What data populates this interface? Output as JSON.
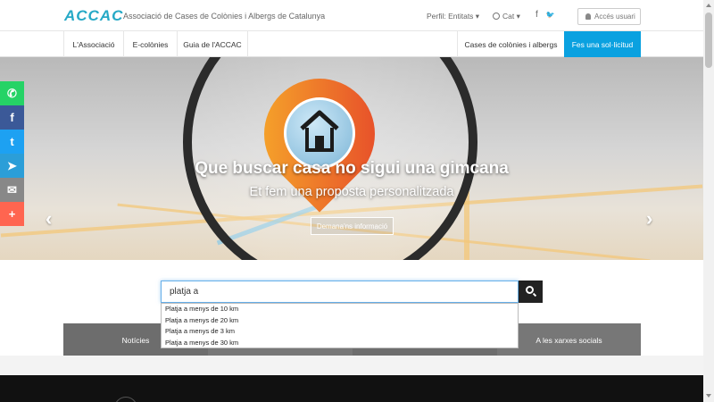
{
  "header": {
    "logo": "ACCAC",
    "tagline": "Associació de Cases de Colònies i Albergs de Catalunya",
    "perfil": "Perfil: Entitats ▾",
    "lang": "Cat ▾",
    "facebook_icon": "f",
    "twitter_icon": "🐦",
    "login": "Accés usuari"
  },
  "nav": {
    "items": [
      "L'Associació",
      "E-colònies",
      "Guia de l'ACCAC"
    ],
    "cases": "Cases de colònies i albergs",
    "solicitud": "Fes una sol·licitud"
  },
  "hero": {
    "title": "Que buscar casa no sigui una gimcana",
    "subtitle": "Et fem una proposta personalitzada",
    "button": "Demana'ns informació",
    "prev": "‹",
    "next": "›"
  },
  "share": {
    "whatsapp": "✆",
    "facebook": "f",
    "twitter": "t",
    "telegram": "➤",
    "mail": "✉",
    "more": "+"
  },
  "search": {
    "value": "platja a",
    "suggestions": [
      "Platja a menys de 10 km",
      "Platja a menys de 20 km",
      "Platja a menys de 3 km",
      "Platja a menys de 30 km"
    ]
  },
  "tiles": {
    "news": "Notícies",
    "social": "A les xarxes socials"
  },
  "colors": {
    "accent": "#0aa1e0",
    "logo": "#26a9c6"
  }
}
